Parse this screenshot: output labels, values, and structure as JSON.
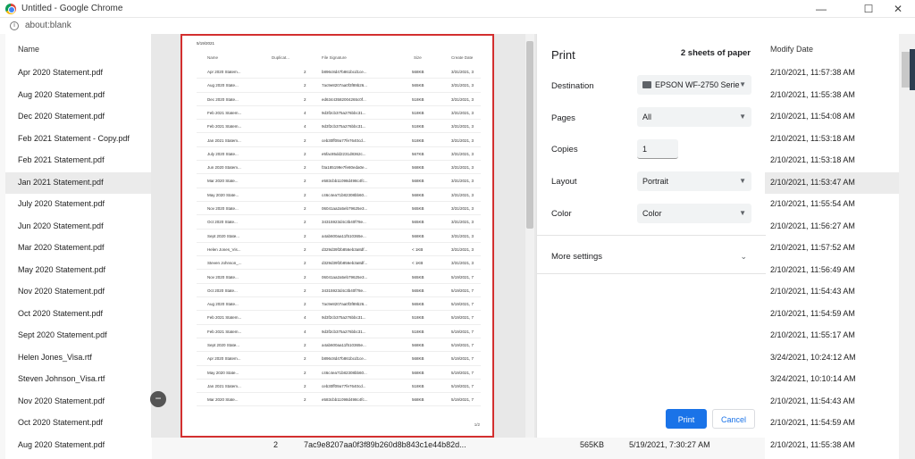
{
  "window": {
    "title": "Untitled - Google Chrome",
    "url": "about:blank",
    "controls": {
      "minimize": "—",
      "maximize": "☐",
      "close": "✕"
    }
  },
  "background": {
    "name_header": "Name",
    "modify_header": "Modify Date",
    "rows": [
      {
        "name": "Apr 2020 Statement.pdf",
        "date": "2/10/2021, 11:57:38 AM"
      },
      {
        "name": "Aug 2020 Statement.pdf",
        "date": "2/10/2021, 11:55:38 AM"
      },
      {
        "name": "Dec 2020 Statement.pdf",
        "date": "2/10/2021, 11:54:08 AM"
      },
      {
        "name": "Feb 2021 Statement - Copy.pdf",
        "date": "2/10/2021, 11:53:18 AM"
      },
      {
        "name": "Feb 2021 Statement.pdf",
        "date": "2/10/2021, 11:53:18 AM"
      },
      {
        "name": "Jan 2021 Statement.pdf",
        "date": "2/10/2021, 11:53:47 AM"
      },
      {
        "name": "July 2020 Statement.pdf",
        "date": "2/10/2021, 11:55:54 AM"
      },
      {
        "name": "Jun 2020 Statement.pdf",
        "date": "2/10/2021, 11:56:27 AM"
      },
      {
        "name": "Mar 2020 Statement.pdf",
        "date": "2/10/2021, 11:57:52 AM"
      },
      {
        "name": "May 2020 Statement.pdf",
        "date": "2/10/2021, 11:56:49 AM"
      },
      {
        "name": "Nov 2020 Statement.pdf",
        "date": "2/10/2021, 11:54:43 AM"
      },
      {
        "name": "Oct 2020 Statement.pdf",
        "date": "2/10/2021, 11:54:59 AM"
      },
      {
        "name": "Sept 2020 Statement.pdf",
        "date": "2/10/2021, 11:55:17 AM"
      },
      {
        "name": "Helen Jones_Visa.rtf",
        "date": "3/24/2021, 10:24:12 AM"
      },
      {
        "name": "Steven Johnson_Visa.rtf",
        "date": "3/24/2021, 10:10:14 AM"
      },
      {
        "name": "Nov 2020 Statement.pdf",
        "date": "2/10/2021, 11:54:43 AM"
      },
      {
        "name": "Oct 2020 Statement.pdf",
        "date": "2/10/2021, 11:54:59 AM"
      },
      {
        "name": "Aug 2020 Statement.pdf",
        "date": "2/10/2021, 11:55:38 AM"
      }
    ],
    "last_row_extra": {
      "dup": "2",
      "sig": "7ac9e8207aa0f3f89b260d8b843c1e44b82d...",
      "size": "565KB",
      "cdate": "5/19/2021, 7:30:27 AM"
    }
  },
  "preview": {
    "date": "5/19/2021",
    "headers": [
      "Name",
      "Duplicat...",
      "File Signature",
      "Size",
      "Create Date"
    ],
    "rows": [
      [
        "Apr 2020 Statem...",
        "2",
        "b896c8d47b861bcd1ce...",
        "568KB",
        "3/31/2021, 3"
      ],
      [
        "Aug 2020 State...",
        "2",
        "7ac9e8207aa0f3f89b26...",
        "565KB",
        "3/31/2021, 3"
      ],
      [
        "Dec 2020 State...",
        "2",
        "ed63443582004265c0f...",
        "518KB",
        "3/31/2021, 3"
      ],
      [
        "Feb 2021 Statem...",
        "4",
        "9d3f2cb375a276bbc31...",
        "518KB",
        "3/31/2021, 3"
      ],
      [
        "Feb 2021 Statem...",
        "4",
        "9d3f2cb375a276bbc31...",
        "518KB",
        "3/31/2021, 3"
      ],
      [
        "Jan 2021 Statem...",
        "2",
        "ceb30ff09a77fe7640cd...",
        "518KB",
        "3/31/2021, 3"
      ],
      [
        "July 2020 State...",
        "2",
        "e5fac85dd2231d8362c...",
        "567KB",
        "3/31/2021, 3"
      ],
      [
        "Jun 2020 Statem...",
        "2",
        "f3a185199e7fe80eda0e...",
        "568KB",
        "3/31/2021, 3"
      ],
      [
        "Mar 2020 State...",
        "2",
        "e583cbb11098d498c4fc...",
        "568KB",
        "3/31/2021, 3"
      ],
      [
        "May 2020 State...",
        "2",
        "c46c4ea71b82308bb60...",
        "568KB",
        "3/31/2021, 3"
      ],
      [
        "Nov 2020 State...",
        "2",
        "06041aa2a5eb79625e3...",
        "565KB",
        "3/31/2021, 3"
      ],
      [
        "Oct 2020 State...",
        "2",
        "34315923d4c3b40f78e...",
        "565KB",
        "3/31/2021, 3"
      ],
      [
        "Sept 2020 State...",
        "2",
        "a4ab600aa11f510365e...",
        "568KB",
        "3/31/2021, 3"
      ],
      [
        "Helen Jones_Vis...",
        "2",
        "d329d39f2b856eb3a8df...",
        "< 1KB",
        "3/31/2021, 3"
      ],
      [
        "Steven Johnson_...",
        "2",
        "d329d39f2b856eb3a8df...",
        "< 1KB",
        "3/31/2021, 3"
      ],
      [
        "Nov 2020 State...",
        "2",
        "06041aa2a5eb79625e3...",
        "565KB",
        "5/19/2021, 7"
      ],
      [
        "Oct 2020 State...",
        "2",
        "34315923d4c3b40f78e...",
        "565KB",
        "5/19/2021, 7"
      ],
      [
        "Aug 2020 State...",
        "2",
        "7ac9e8207aa0f3f89b26...",
        "565KB",
        "5/19/2021, 7"
      ],
      [
        "Feb 2021 Statem...",
        "4",
        "9d3f2cb375a276bbc31...",
        "518KB",
        "5/19/2021, 7"
      ],
      [
        "Feb 2021 Statem...",
        "4",
        "9d3f2cb375a276bbc31...",
        "518KB",
        "5/19/2021, 7"
      ],
      [
        "Sept 2020 State...",
        "2",
        "a4ab600aa11f510365e...",
        "568KB",
        "5/19/2021, 7"
      ],
      [
        "Apr 2020 Statem...",
        "2",
        "b896c8d47b861bcd1ce...",
        "568KB",
        "5/19/2021, 7"
      ],
      [
        "May 2020 State...",
        "2",
        "c46c4ea71b82308bb60...",
        "568KB",
        "5/19/2021, 7"
      ],
      [
        "Jan 2021 Statem...",
        "2",
        "ceb30ff09a77fe7640cd...",
        "518KB",
        "5/19/2021, 7"
      ],
      [
        "Mar 2020 State...",
        "2",
        "e583cbb11098d498c4fc...",
        "568KB",
        "5/19/2021, 7"
      ]
    ],
    "page_number": "1/2",
    "zoom_out": "−"
  },
  "print": {
    "title": "Print",
    "sheets": "2 sheets of paper",
    "destination_label": "Destination",
    "destination_value": "EPSON WF-2750 Serie",
    "pages_label": "Pages",
    "pages_value": "All",
    "copies_label": "Copies",
    "copies_value": "1",
    "layout_label": "Layout",
    "layout_value": "Portrait",
    "color_label": "Color",
    "color_value": "Color",
    "more_settings": "More settings",
    "print_button": "Print",
    "cancel_button": "Cancel"
  }
}
